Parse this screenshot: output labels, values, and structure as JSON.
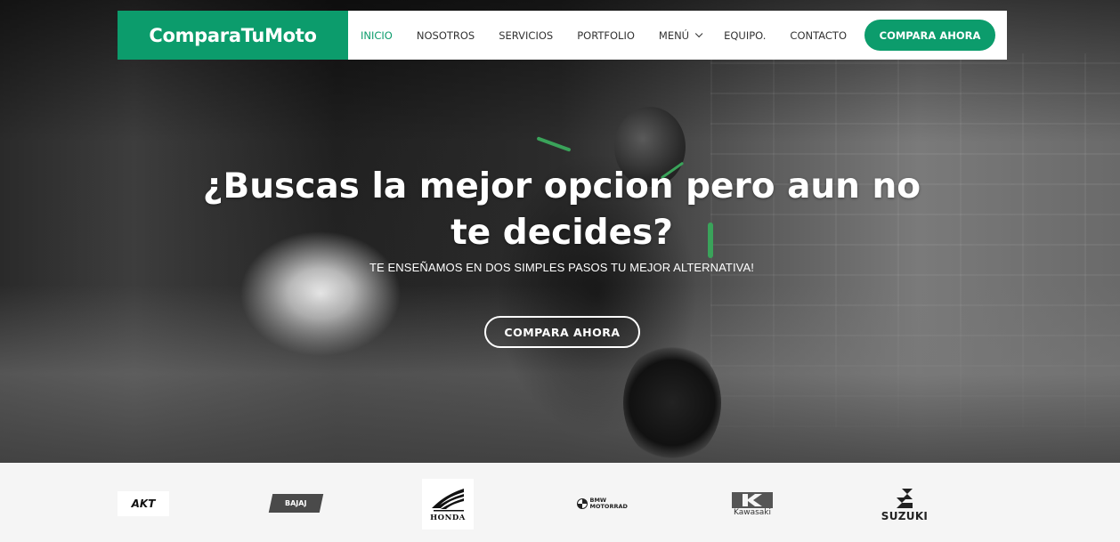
{
  "nav": {
    "brand": "ComparaTuMoto",
    "items": [
      {
        "label": "INICIO",
        "active": true
      },
      {
        "label": "NOSOTROS",
        "active": false
      },
      {
        "label": "SERVICIOS",
        "active": false
      },
      {
        "label": "PORTFOLIO",
        "active": false
      },
      {
        "label": "MENÚ",
        "active": false,
        "has_dropdown": true
      },
      {
        "label": "EQUIPO.",
        "active": false
      },
      {
        "label": "CONTACTO",
        "active": false
      }
    ],
    "cta_label": "COMPARA AHORA"
  },
  "hero": {
    "title": "¿Buscas la mejor opcion pero aun no te decides?",
    "subtitle": "TE ENSEÑAMOS EN DOS SIMPLES PASOS TU MEJOR ALTERNATIVA!",
    "cta_label": "COMPARA AHORA"
  },
  "brands": [
    {
      "name": "AKT"
    },
    {
      "name": "BAJAJ"
    },
    {
      "name": "HONDA"
    },
    {
      "name": "BMW MOTORRAD"
    },
    {
      "name": "Kawasaki"
    },
    {
      "name": "SUZUKI"
    }
  ],
  "colors": {
    "accent": "#0c9c6c",
    "nav_bg": "#ffffff",
    "text_dark": "#333333",
    "brands_bg": "#f5f5f5"
  }
}
